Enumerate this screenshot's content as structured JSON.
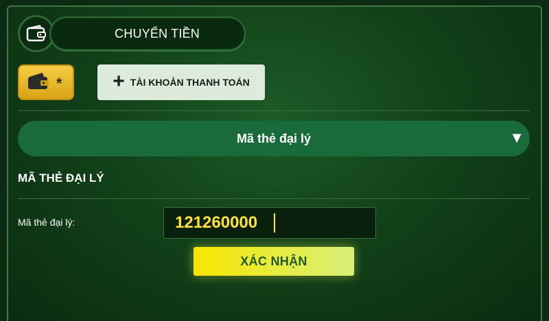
{
  "header": {
    "title": "CHUYỂN TIỀN",
    "icon": "wallet-icon"
  },
  "tabs": {
    "wallet_tab": {
      "icon": "wallet-icon",
      "marker": "*"
    },
    "add_account": {
      "icon": "plus-icon",
      "label": "TÀI KHOẢN THANH TOÁN"
    }
  },
  "method_select": {
    "selected": "Mã thẻ đại lý",
    "icon": "caret-down-icon"
  },
  "section": {
    "title": "MÃ THẺ ĐẠI LÝ"
  },
  "form": {
    "agent_card_label": "Mã thẻ đại lý:",
    "agent_card_value": "121260000"
  },
  "confirm_button": {
    "label": "XÁC NHẬN"
  },
  "colors": {
    "accent_gold": "#f5cd45",
    "input_text": "#ffe23a",
    "select_bg": "#1a6b3c",
    "confirm_bg": "#f6e600"
  }
}
